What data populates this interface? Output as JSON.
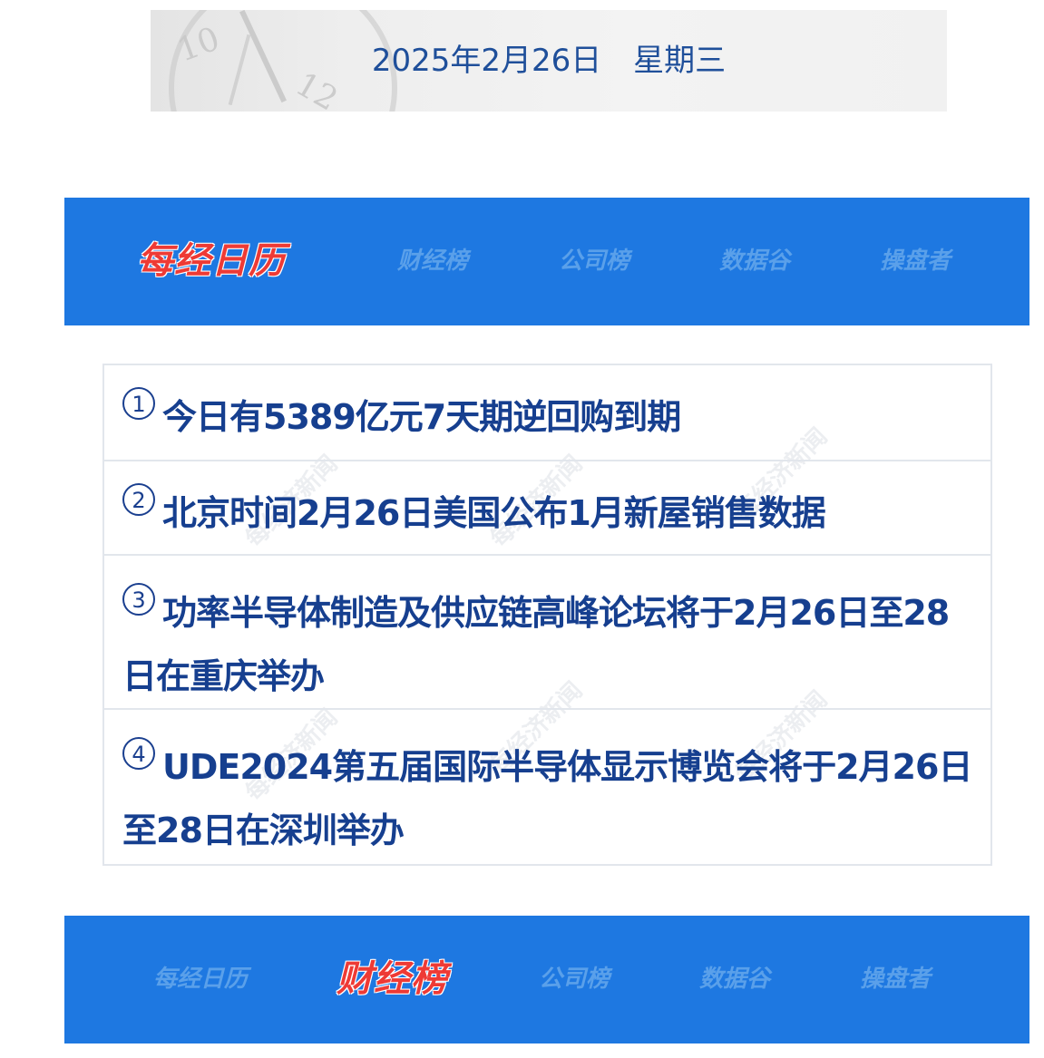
{
  "date_banner": {
    "date": "2025年2月26日",
    "weekday": "星期三",
    "clock_numbers": [
      "10",
      "12"
    ]
  },
  "nav_top": {
    "items": [
      {
        "label": "每经日历",
        "active": true
      },
      {
        "label": "财经榜",
        "active": false
      },
      {
        "label": "公司榜",
        "active": false
      },
      {
        "label": "数据谷",
        "active": false
      },
      {
        "label": "操盘者",
        "active": false
      }
    ]
  },
  "news": {
    "watermark": "每经济新闻",
    "items": [
      {
        "num": "1",
        "text": "今日有5389亿元7天期逆回购到期"
      },
      {
        "num": "2",
        "text": "北京时间2月26日美国公布1月新屋销售数据"
      },
      {
        "num": "3",
        "text": "功率半导体制造及供应链高峰论坛将于2月26日至28日在重庆举办"
      },
      {
        "num": "4",
        "text": "UDE2024第五届国际半导体显示博览会将于2月26日至28日在深圳举办"
      }
    ]
  },
  "nav_bottom": {
    "items": [
      {
        "label": "每经日历",
        "active": false
      },
      {
        "label": "财经榜",
        "active": true
      },
      {
        "label": "公司榜",
        "active": false
      },
      {
        "label": "数据谷",
        "active": false
      },
      {
        "label": "操盘者",
        "active": false
      }
    ]
  },
  "colors": {
    "nav_bg": "#1e78e1",
    "nav_inactive": "#5aa0ea",
    "nav_active": "#ee3a35",
    "news_text": "#163f8f",
    "date_text": "#1f4f9a"
  }
}
